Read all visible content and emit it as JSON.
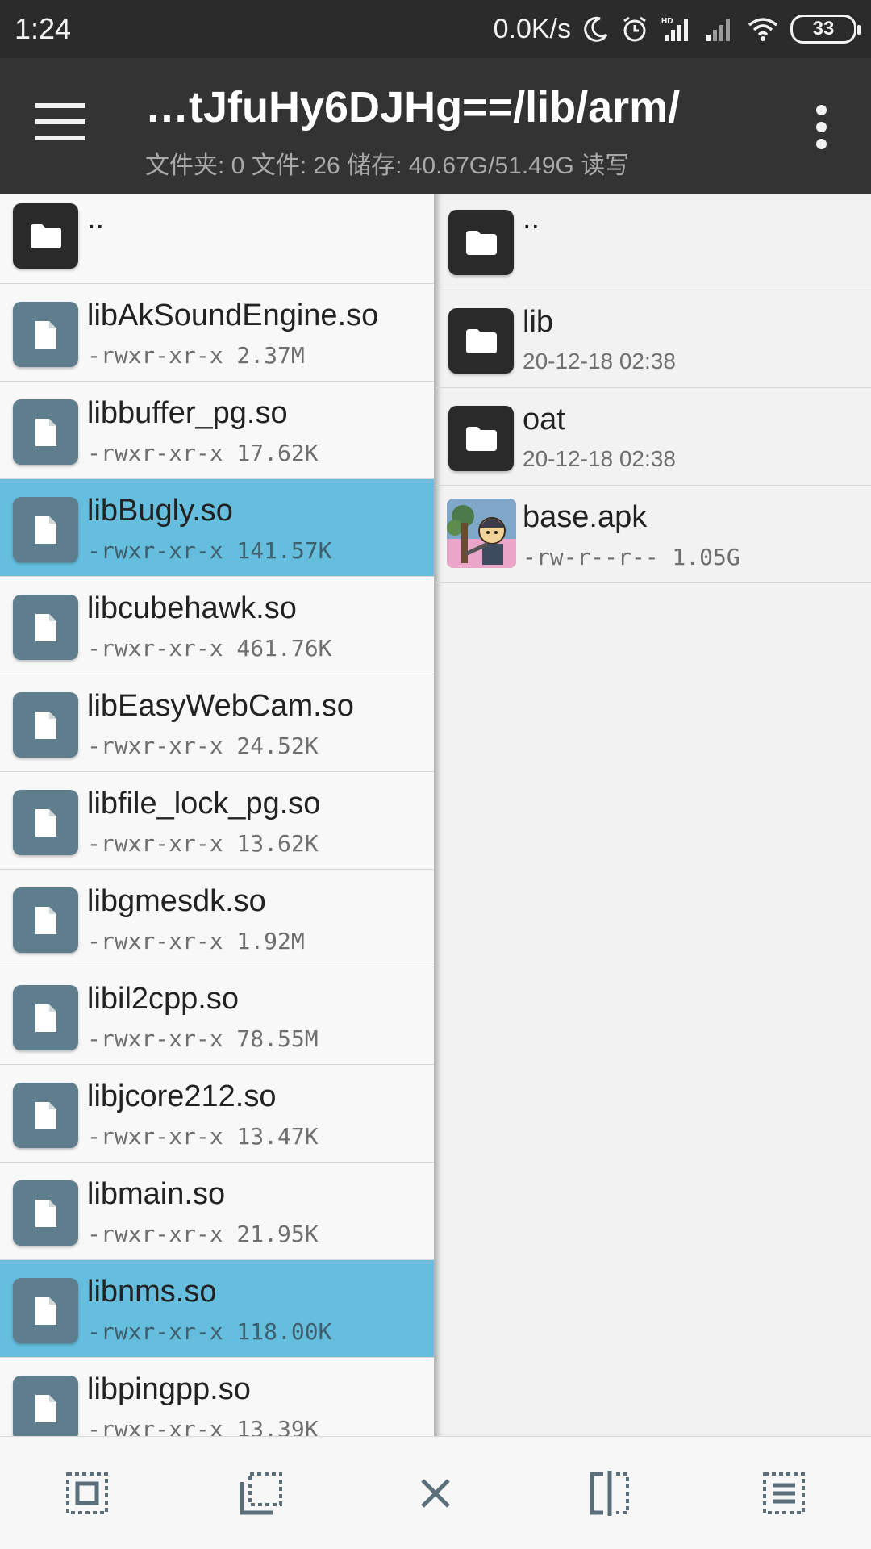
{
  "status_bar": {
    "time": "1:24",
    "net_speed": "0.0K/s",
    "battery": "33",
    "icons": [
      "moon-icon",
      "alarm-icon",
      "hd-signal-icon",
      "signal-icon",
      "wifi-icon",
      "battery-icon"
    ]
  },
  "app_bar": {
    "path": "…tJfuHy6DJHg==/lib/arm/",
    "summary": "文件夹: 0  文件: 26  储存: 40.67G/51.49G  读写",
    "menu_icon": "hamburger-menu-icon",
    "more_icon": "more-vert-icon"
  },
  "left_pane": {
    "up_label": "..",
    "files": [
      {
        "name": "libAkSoundEngine.so",
        "meta": "-rwxr-xr-x 2.37M",
        "selected": false
      },
      {
        "name": "libbuffer_pg.so",
        "meta": "-rwxr-xr-x 17.62K",
        "selected": false
      },
      {
        "name": "libBugly.so",
        "meta": "-rwxr-xr-x 141.57K",
        "selected": true
      },
      {
        "name": "libcubehawk.so",
        "meta": "-rwxr-xr-x 461.76K",
        "selected": false
      },
      {
        "name": "libEasyWebCam.so",
        "meta": "-rwxr-xr-x 24.52K",
        "selected": false
      },
      {
        "name": "libfile_lock_pg.so",
        "meta": "-rwxr-xr-x 13.62K",
        "selected": false
      },
      {
        "name": "libgmesdk.so",
        "meta": "-rwxr-xr-x 1.92M",
        "selected": false
      },
      {
        "name": "libil2cpp.so",
        "meta": "-rwxr-xr-x 78.55M",
        "selected": false
      },
      {
        "name": "libjcore212.so",
        "meta": "-rwxr-xr-x 13.47K",
        "selected": false
      },
      {
        "name": "libmain.so",
        "meta": "-rwxr-xr-x 21.95K",
        "selected": false
      },
      {
        "name": "libnms.so",
        "meta": "-rwxr-xr-x 118.00K",
        "selected": true
      },
      {
        "name": "libpingpp.so",
        "meta": "-rwxr-xr-x 13.39K",
        "selected": false
      }
    ]
  },
  "right_pane": {
    "up_label": "..",
    "items": [
      {
        "name": "lib",
        "meta": "20-12-18 02:38",
        "kind": "folder"
      },
      {
        "name": "oat",
        "meta": "20-12-18 02:38",
        "kind": "folder"
      },
      {
        "name": "base.apk",
        "meta": "-rw-r--r-- 1.05G",
        "kind": "apk"
      }
    ]
  },
  "bottom_bar": {
    "buttons": [
      "select-all-icon",
      "select-range-icon",
      "close-icon",
      "split-view-icon",
      "list-view-icon"
    ]
  },
  "colors": {
    "appbar": "#333333",
    "statusbar": "#2b2b2b",
    "selected": "#66bede",
    "file_icon": "#5e7d8d",
    "folder_icon": "#2a2a2a"
  }
}
